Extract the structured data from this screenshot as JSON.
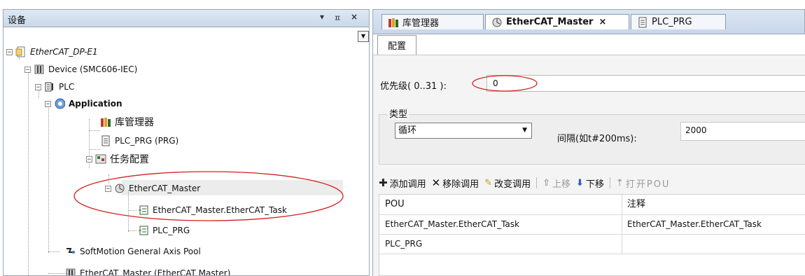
{
  "left_panel": {
    "title": "设备",
    "header_buttons": [
      "▾",
      "ㅍ",
      "×"
    ],
    "tree": {
      "root": "EtherCAT_DP-E1",
      "device": "Device (SMC606-IEC)",
      "plc": "PLC",
      "application": "Application",
      "library_manager": "库管理器",
      "plc_prg": "PLC_PRG (PRG)",
      "task_config": "任务配置",
      "ethercat_master_task": "EtherCAT_Master",
      "ethercat_task_item": "EtherCAT_Master.EtherCAT_Task",
      "plc_prg_item": "PLC_PRG",
      "softmotion": "SoftMotion General Axis Pool",
      "ethercat_master_device": "EtherCAT_Master (EtherCAT Master)"
    }
  },
  "tabs": [
    {
      "label": "库管理器"
    },
    {
      "label": "EtherCAT_Master",
      "close": "×"
    },
    {
      "label": "PLC_PRG"
    }
  ],
  "subtab": "配置",
  "config": {
    "priority_label": "优先级( 0..31 ):",
    "priority_value": "0",
    "type_group_title": "类型",
    "type_value": "循环",
    "interval_label": "间隔(如t#200ms):",
    "interval_value": "2000"
  },
  "toolbar": {
    "add_call": "添加调用",
    "remove_call": "移除调用",
    "change_call": "改变调用",
    "move_up": "上移",
    "move_down": "下移",
    "open_pou": "打开POU"
  },
  "table": {
    "headers": [
      "POU",
      "注释"
    ],
    "rows": [
      [
        "EtherCAT_Master.EtherCAT_Task",
        "EtherCAT_Master.EtherCAT_Task"
      ],
      [
        "PLC_PRG",
        ""
      ]
    ]
  },
  "colors": {
    "annotation_red": "#d42020",
    "panel_header": "#d6e2f0",
    "selection": "#ececec"
  }
}
